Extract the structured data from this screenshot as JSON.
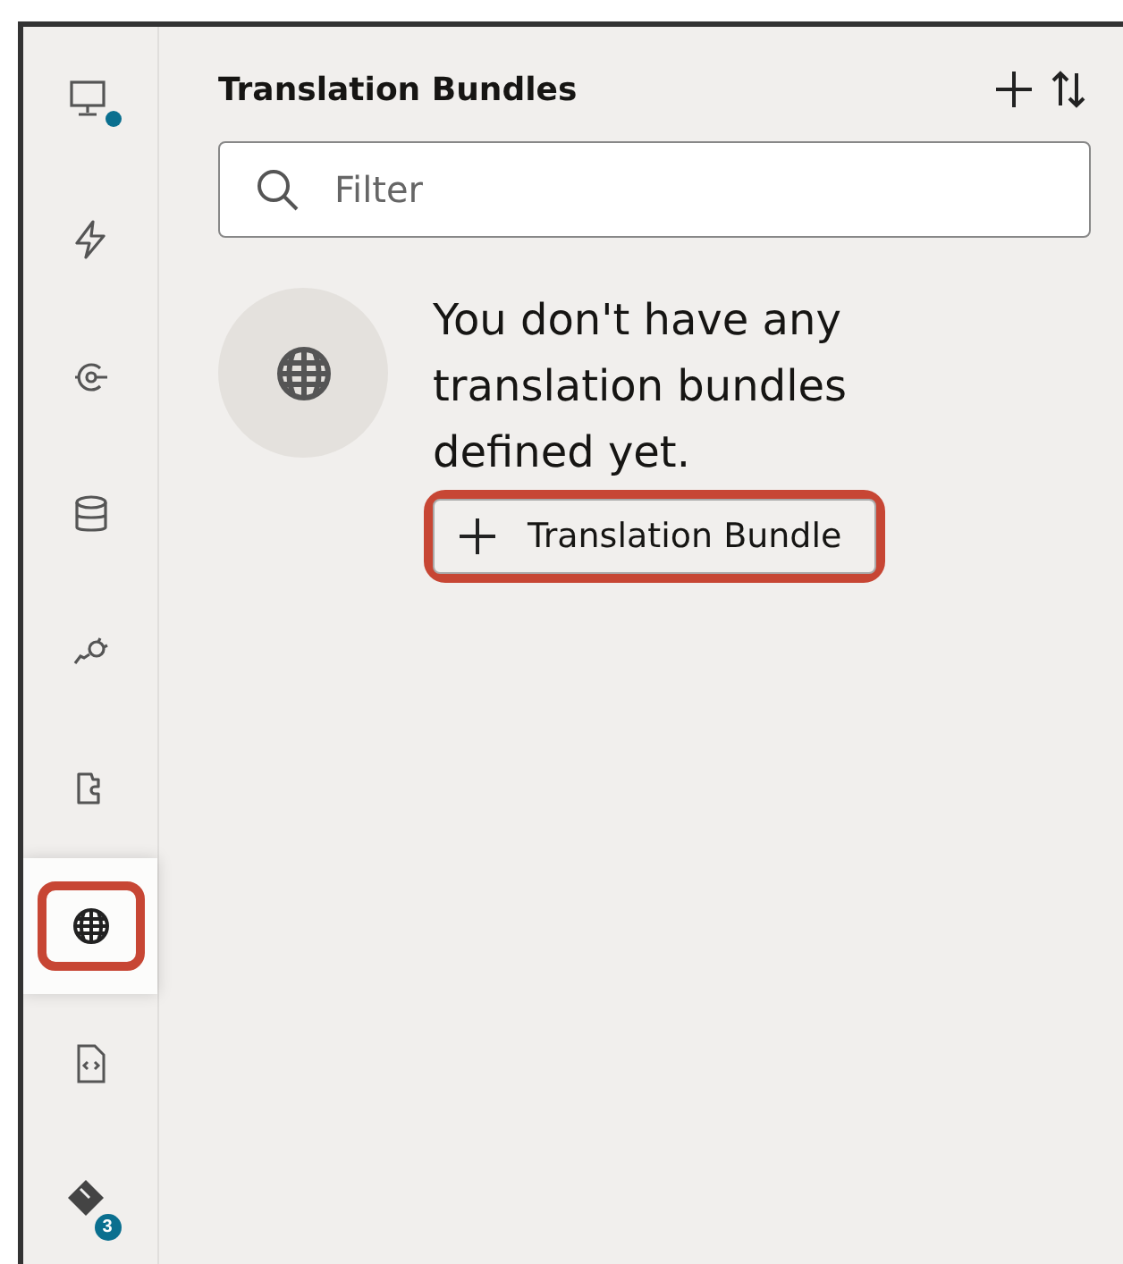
{
  "sidebar": {
    "items": [
      {
        "kind": "monitor",
        "selected": false,
        "highlighted": false,
        "dot": true
      },
      {
        "kind": "bolt",
        "selected": false,
        "highlighted": false,
        "dot": false
      },
      {
        "kind": "target",
        "selected": false,
        "highlighted": false,
        "dot": false
      },
      {
        "kind": "database",
        "selected": false,
        "highlighted": false,
        "dot": false
      },
      {
        "kind": "plug",
        "selected": false,
        "highlighted": false,
        "dot": false
      },
      {
        "kind": "puzzle",
        "selected": false,
        "highlighted": false,
        "dot": false
      },
      {
        "kind": "globe",
        "selected": true,
        "highlighted": true,
        "dot": false
      },
      {
        "kind": "code-file",
        "selected": false,
        "highlighted": false,
        "dot": false
      },
      {
        "kind": "git",
        "selected": false,
        "highlighted": false,
        "dot": false,
        "badge": "3"
      }
    ]
  },
  "panel": {
    "title": "Translation Bundles",
    "search": {
      "placeholder": "Filter"
    },
    "empty_state": {
      "message": "You don't have any translation bundles defined yet.",
      "button": {
        "label": "Translation Bundle",
        "highlighted": true
      }
    }
  }
}
